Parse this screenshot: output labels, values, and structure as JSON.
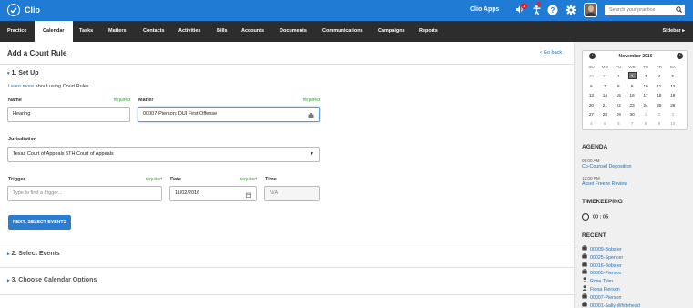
{
  "app": {
    "name": "Clio",
    "apps_link": "Clio Apps",
    "notifications_count": "1",
    "search_placeholder": "Search your practice"
  },
  "nav": {
    "items": [
      "Practice",
      "Calendar",
      "Tasks",
      "Matters",
      "Contacts",
      "Activities",
      "Bills",
      "Accounts",
      "Documents",
      "Communications",
      "Campaigns",
      "Reports"
    ],
    "active": "Calendar",
    "sidebar_label": "Sidebar"
  },
  "page": {
    "title": "Add a Court Rule",
    "go_back": "Go back"
  },
  "setup": {
    "title": "1. Set Up",
    "learn_link": "Learn more",
    "learn_text": " about using Court Rules.",
    "name_label": "Name",
    "name_required": "required",
    "name_value": "Hearing",
    "matter_label": "Matter",
    "matter_required": "required",
    "matter_value": "00007-Pierson: DUI  First Offense",
    "jurisdiction_label": "Jurisdiction",
    "jurisdiction_value": "Texas Court of Appeals 5TH Court of Appeals",
    "trigger_label": "Trigger",
    "trigger_required": "required",
    "trigger_placeholder": "Type to find a trigger...",
    "date_label": "Date",
    "date_required": "required",
    "date_value": "11/02/2016",
    "time_label": "Time",
    "time_placeholder": "N/A",
    "next_button": "NEXT: SELECT EVENTS"
  },
  "sections": {
    "select_events": "2. Select Events",
    "calendar_options": "3. Choose Calendar Options"
  },
  "calendar": {
    "month": "November 2016",
    "weekdays": [
      "SU",
      "MO",
      "TU",
      "WE",
      "TH",
      "FR",
      "SA"
    ],
    "weeks": [
      [
        "30",
        "31",
        "1",
        "2",
        "3",
        "4",
        "5"
      ],
      [
        "6",
        "7",
        "8",
        "9",
        "10",
        "11",
        "12"
      ],
      [
        "13",
        "14",
        "15",
        "16",
        "17",
        "18",
        "19"
      ],
      [
        "20",
        "21",
        "22",
        "23",
        "24",
        "25",
        "26"
      ],
      [
        "27",
        "28",
        "29",
        "30",
        "1",
        "2",
        "3"
      ],
      [
        "4",
        "5",
        "6",
        "7",
        "8",
        "9",
        "10"
      ]
    ],
    "selected": "2"
  },
  "agenda": {
    "title": "AGENDA",
    "events": [
      {
        "time": "09:00 AM",
        "title": "Co-Counsel Deposition"
      },
      {
        "time": "12:00 PM",
        "title": "Asset Freeze Review"
      }
    ]
  },
  "timekeeping": {
    "title": "TIMEKEEPING",
    "timer": "00 : 05"
  },
  "recent": {
    "title": "RECENT",
    "items": [
      {
        "label": "00009-Bobster",
        "icon": "briefcase-icon"
      },
      {
        "label": "00025-Spencer",
        "icon": "briefcase-icon"
      },
      {
        "label": "00016-Bobster",
        "icon": "briefcase-icon"
      },
      {
        "label": "00005-Pierson",
        "icon": "briefcase-icon"
      },
      {
        "label": "Rose Tyler",
        "icon": "person-icon"
      },
      {
        "label": "Fiona Pierson",
        "icon": "person-icon"
      },
      {
        "label": "00007-Pierson",
        "icon": "briefcase-icon"
      },
      {
        "label": "00001-Sally Whitehead",
        "icon": "briefcase-icon"
      }
    ]
  },
  "colors": {
    "brand_blue": "#1f7bd4",
    "nav_dark": "#2d2d2d",
    "required_green": "#3a9d3a",
    "link_blue": "#1f6fb5"
  }
}
